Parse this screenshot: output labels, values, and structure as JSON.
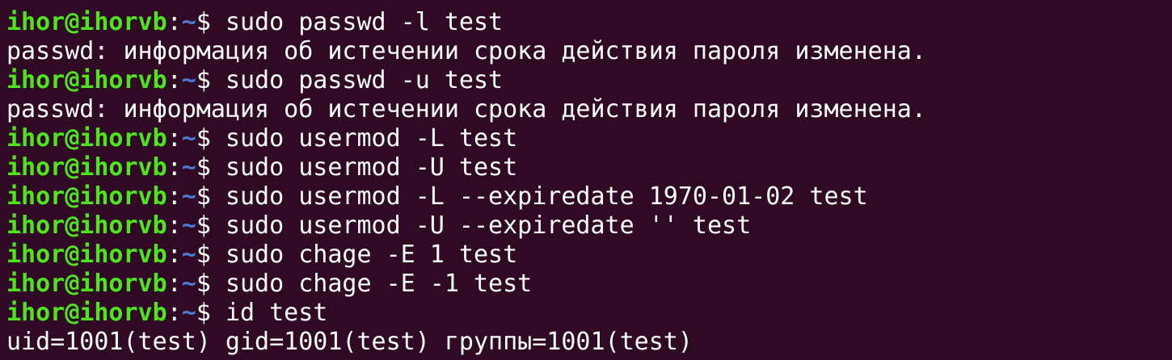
{
  "terminal": {
    "colors": {
      "background": "#300a24",
      "prompt_user_host": "#4ee61a",
      "prompt_path": "#4b7bd6",
      "text": "#ffffff"
    },
    "lines": [
      {
        "type": "prompt",
        "user_host": "ihor@ihorvb",
        "sep": ":",
        "path": "~",
        "dollar": "$ ",
        "command": "sudo passwd -l test"
      },
      {
        "type": "output",
        "text": "passwd: информация об истечении срока действия пароля изменена."
      },
      {
        "type": "prompt",
        "user_host": "ihor@ihorvb",
        "sep": ":",
        "path": "~",
        "dollar": "$ ",
        "command": "sudo passwd -u test"
      },
      {
        "type": "output",
        "text": "passwd: информация об истечении срока действия пароля изменена."
      },
      {
        "type": "prompt",
        "user_host": "ihor@ihorvb",
        "sep": ":",
        "path": "~",
        "dollar": "$ ",
        "command": "sudo usermod -L test"
      },
      {
        "type": "prompt",
        "user_host": "ihor@ihorvb",
        "sep": ":",
        "path": "~",
        "dollar": "$ ",
        "command": "sudo usermod -U test"
      },
      {
        "type": "prompt",
        "user_host": "ihor@ihorvb",
        "sep": ":",
        "path": "~",
        "dollar": "$ ",
        "command": "sudo usermod -L --expiredate 1970-01-02 test"
      },
      {
        "type": "prompt",
        "user_host": "ihor@ihorvb",
        "sep": ":",
        "path": "~",
        "dollar": "$ ",
        "command": "sudo usermod -U --expiredate '' test"
      },
      {
        "type": "prompt",
        "user_host": "ihor@ihorvb",
        "sep": ":",
        "path": "~",
        "dollar": "$ ",
        "command": "sudo chage -E 1 test"
      },
      {
        "type": "prompt",
        "user_host": "ihor@ihorvb",
        "sep": ":",
        "path": "~",
        "dollar": "$ ",
        "command": "sudo chage -E -1 test"
      },
      {
        "type": "prompt",
        "user_host": "ihor@ihorvb",
        "sep": ":",
        "path": "~",
        "dollar": "$ ",
        "command": "id test"
      },
      {
        "type": "output",
        "text": "uid=1001(test) gid=1001(test) группы=1001(test)"
      }
    ]
  }
}
